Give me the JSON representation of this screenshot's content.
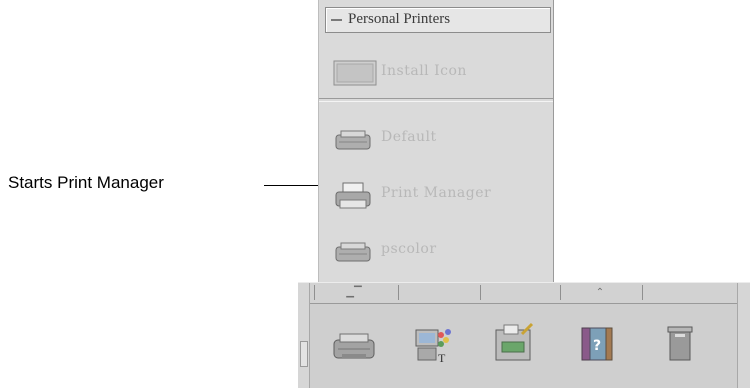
{
  "callout": {
    "text": "Starts Print Manager"
  },
  "subpanel": {
    "title": "Personal Printers",
    "install_label": "Install Icon",
    "items": [
      {
        "label": "Default",
        "icon": "printer-icon"
      },
      {
        "label": "Print Manager",
        "icon": "print-manager-icon"
      },
      {
        "label": "pscolor",
        "icon": "printer-icon"
      }
    ]
  },
  "front_panel": {
    "arrow_up_glyph": "⌃",
    "icons": [
      "printer-icon",
      "style-manager-icon",
      "application-manager-icon",
      "help-icon",
      "trash-icon"
    ]
  }
}
